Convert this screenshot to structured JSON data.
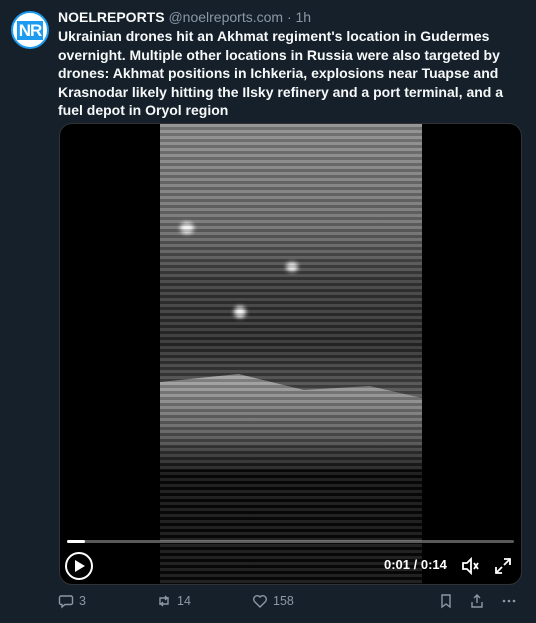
{
  "tweet": {
    "avatar_text": "NR",
    "display_name": "NOELREPORTS",
    "handle": "@noelreports.com",
    "separator": "·",
    "time": "1h",
    "text": "Ukrainian drones hit an Akhmat regiment's location in Gudermes overnight. Multiple other locations in Russia were also targeted by drones: Akhmat positions in Ichkeria, explosions near Tuapse and Krasnodar likely hitting the Ilsky refinery and a port terminal, and a fuel depot in Oryol region"
  },
  "video": {
    "time_readout": "0:01 / 0:14",
    "progress_fraction": 0.04
  },
  "actions": {
    "replies": "3",
    "retweets": "14",
    "likes": "158"
  },
  "icons": {
    "play": "play-icon",
    "volume": "volume-icon",
    "fullscreen": "fullscreen-icon",
    "reply": "reply-icon",
    "retweet": "retweet-icon",
    "like": "heart-icon",
    "bookmark": "bookmark-icon",
    "share": "share-icon",
    "more": "more-icon"
  },
  "colors": {
    "background": "#15202b",
    "accent": "#1d9bf0",
    "muted": "#8b98a5"
  }
}
